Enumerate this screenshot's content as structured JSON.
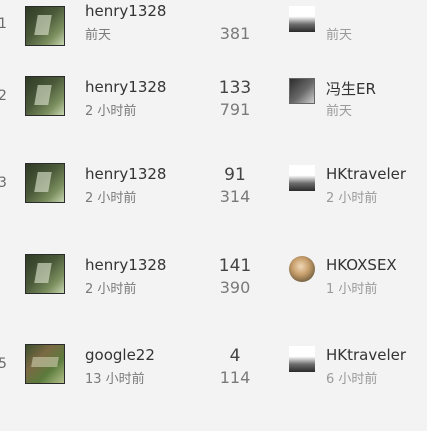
{
  "rows": [
    {
      "rank": "1",
      "user": "henry1328",
      "time": "前天",
      "views": "",
      "posts": "381",
      "last_user": "",
      "last_time": "前天"
    },
    {
      "rank": "2",
      "user": "henry1328",
      "time": "2 小时前",
      "views": "133",
      "posts": "791",
      "last_user": "冯生ER",
      "last_time": "前天"
    },
    {
      "rank": "3",
      "user": "henry1328",
      "time": "2 小时前",
      "views": "91",
      "posts": "314",
      "last_user": "HKtraveler",
      "last_time": "2 小时前"
    },
    {
      "rank": "",
      "user": "henry1328",
      "time": "2 小时前",
      "views": "141",
      "posts": "390",
      "last_user": "HKOXSEX",
      "last_time": "1 小时前"
    },
    {
      "rank": "5",
      "user": "google22",
      "time": "13 小时前",
      "views": "4",
      "posts": "114",
      "last_user": "HKtraveler",
      "last_time": "6 小时前"
    }
  ]
}
